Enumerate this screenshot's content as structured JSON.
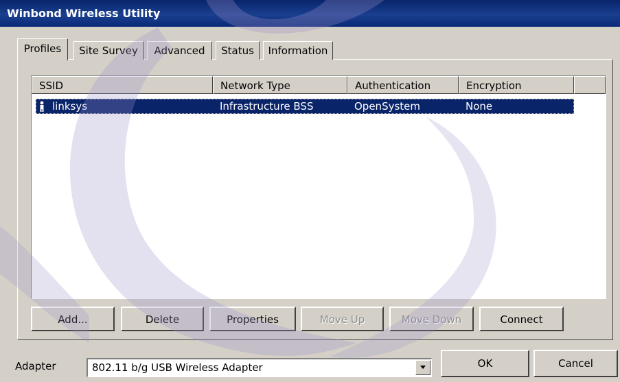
{
  "window": {
    "title": "Winbond Wireless Utility"
  },
  "tabs": [
    {
      "label": "Profiles",
      "active": true
    },
    {
      "label": "Site Survey",
      "active": false
    },
    {
      "label": "Advanced",
      "active": false
    },
    {
      "label": "Status",
      "active": false
    },
    {
      "label": "Information",
      "active": false
    }
  ],
  "table": {
    "columns": [
      "SSID",
      "Network Type",
      "Authentication",
      "Encryption"
    ],
    "rows": [
      {
        "icon": "person-icon",
        "ssid": "linksys",
        "network_type": "Infrastructure BSS",
        "authentication": "OpenSystem",
        "encryption": "None",
        "selected": true
      }
    ]
  },
  "buttons": {
    "add": "Add...",
    "delete": "Delete",
    "properties": "Properties",
    "move_up": "Move Up",
    "move_down": "Move Down",
    "connect": "Connect",
    "ok": "OK",
    "cancel": "Cancel"
  },
  "adapter": {
    "label": "Adapter",
    "selected": "802.11 b/g USB Wireless Adapter"
  },
  "colors": {
    "titlebar": "#0a246a",
    "selection": "#0a246a",
    "face": "#d4d0c8",
    "watermark": "#9c8fc8"
  }
}
